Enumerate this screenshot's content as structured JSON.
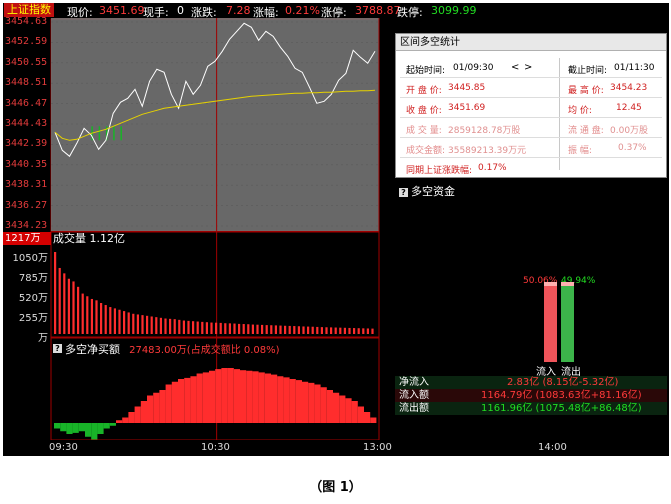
{
  "quote": {
    "index_name": "上证指数",
    "price_label": "现价:",
    "price": "3451.69",
    "hand_label": "现手:",
    "hand": "0",
    "change_label": "涨跌:",
    "change": "7.28",
    "pct_label": "涨幅:",
    "pct": "0.21%",
    "limit_up_label": "涨停:",
    "limit_up": "3788.87",
    "limit_down_label": "跌停:",
    "limit_down": "3099.99"
  },
  "price_axis": [
    "3454.63",
    "3452.59",
    "3450.55",
    "3448.51",
    "3446.47",
    "3444.43",
    "3442.39",
    "3440.35",
    "3438.31",
    "3436.27",
    "3434.23"
  ],
  "volume": {
    "badge": "1217万",
    "title": "成交量 1.12亿",
    "ticks": [
      "1050万",
      "785万",
      "520万",
      "255万",
      "万"
    ]
  },
  "net_buy": {
    "title": "多空净买额",
    "value": "27483.00万(占成交额比 0.08%)"
  },
  "time_axis": [
    "09:30",
    "10:30",
    "13:00",
    "14:00"
  ],
  "stats": {
    "title": "区间多空统计",
    "start_label": "起始时间:",
    "start": "01/09:30",
    "nav_prev": "<",
    "nav_next": ">",
    "end_label": "截止时间:",
    "end": "01/11:30",
    "open_label": "开 盘 价:",
    "open": "3445.85",
    "high_label": "最 高 价:",
    "high": "3454.23",
    "close_label": "收 盘 价:",
    "close": "3451.69",
    "avg_label": "均    价:",
    "avg": "12.45",
    "vol_label": "成 交 量:",
    "vol": "2859128.78万股",
    "float_label": "流 通 盘:",
    "float": "0.00万股",
    "amount_label": "成交金额:",
    "amount": "35589213.39万元",
    "amp_label": "振    幅:",
    "amp": "0.37%",
    "period_label": "同期上证涨跌幅:",
    "period": "0.17%"
  },
  "fund": {
    "title": "多空资金",
    "inflow_pct": "50.06%",
    "outflow_pct": "49.94%",
    "inflow_share": 0.5006,
    "outflow_share": 0.4994,
    "inflow_label": "流入",
    "outflow_label": "流出",
    "rows": [
      {
        "label": "净流入",
        "value": "2.83亿 (8.15亿-5.32亿)"
      },
      {
        "label": "流入额",
        "value": "1164.79亿 (1083.63亿+81.16亿)"
      },
      {
        "label": "流出额",
        "value": "1161.96亿 (1075.48亿+86.48亿)"
      }
    ]
  },
  "caption": "（图 1）",
  "colors": {
    "up": "#ff2d2d",
    "down": "#18b428",
    "price_line": "#ffffff",
    "avg_line": "#e6d200",
    "grid": "#8b0000"
  },
  "series": {
    "price": [
      3443.6,
      3441.8,
      3441.2,
      3442.5,
      3444.0,
      3443.3,
      3441.9,
      3442.8,
      3445.5,
      3446.6,
      3447.0,
      3447.9,
      3446.2,
      3448.7,
      3449.9,
      3449.6,
      3447.4,
      3446.0,
      3448.7,
      3447.4,
      3448.3,
      3450.2,
      3450.7,
      3451.7,
      3452.9,
      3453.7,
      3454.5,
      3454.1,
      3452.8,
      3453.7,
      3453.2,
      3452.1,
      3451.2,
      3450.0,
      3449.6,
      3448.1,
      3446.5,
      3446.7,
      3447.4,
      3448.8,
      3449.5,
      3451.8,
      3451.1,
      3450.5,
      3451.7
    ],
    "avg": [
      3443.6,
      3443.0,
      3442.8,
      3442.9,
      3443.2,
      3443.5,
      3443.7,
      3443.9,
      3444.2,
      3444.5,
      3444.8,
      3445.1,
      3445.4,
      3445.6,
      3445.8,
      3446.0,
      3446.1,
      3446.2,
      3446.3,
      3446.4,
      3446.5,
      3446.6,
      3446.7,
      3446.8,
      3446.9,
      3447.0,
      3447.1,
      3447.2,
      3447.25,
      3447.3,
      3447.35,
      3447.4,
      3447.45,
      3447.5,
      3447.5,
      3447.55,
      3447.55,
      3447.6,
      3447.6,
      3447.65,
      3447.7,
      3447.7,
      3447.75,
      3447.75,
      3447.8
    ],
    "vol_bars": [
      1217,
      980,
      900,
      820,
      780,
      700,
      600,
      560,
      520,
      500,
      460,
      430,
      400,
      380,
      360,
      340,
      320,
      300,
      290,
      280,
      270,
      260,
      250,
      240,
      230,
      225,
      220,
      210,
      200,
      195,
      190,
      185,
      180,
      175,
      170,
      168,
      165,
      160,
      158,
      155,
      150,
      148,
      145,
      140,
      138,
      135,
      132,
      130,
      128,
      125,
      122,
      120,
      118,
      115,
      112,
      110,
      108,
      105,
      102,
      100,
      98,
      96,
      94,
      92,
      90,
      88,
      86,
      84,
      82,
      80
    ],
    "net_buy": [
      -10,
      -15,
      -20,
      -18,
      -15,
      -25,
      -30,
      -20,
      -10,
      -5,
      5,
      10,
      20,
      30,
      40,
      50,
      55,
      60,
      70,
      75,
      80,
      82,
      85,
      90,
      92,
      95,
      98,
      100,
      100,
      98,
      96,
      95,
      94,
      92,
      90,
      88,
      85,
      83,
      80,
      78,
      75,
      73,
      70,
      65,
      60,
      55,
      50,
      45,
      40,
      30,
      20,
      10
    ]
  }
}
